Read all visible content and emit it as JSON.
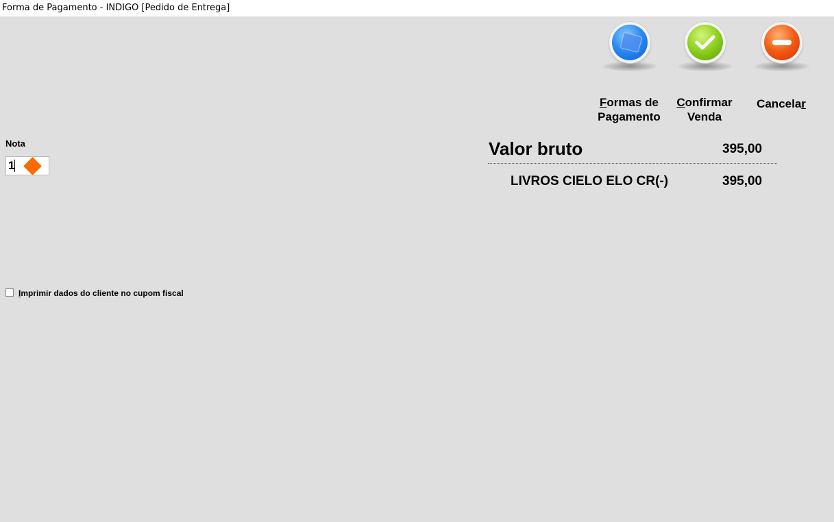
{
  "window": {
    "title": "Forma de Pagamento - INDIGO [Pedido de Entrega]"
  },
  "toolbar": {
    "formas": {
      "line1_first": "F",
      "line1_rest": "ormas de",
      "line2": "Pagamento",
      "icon": "payment-methods-icon"
    },
    "confirmar": {
      "line1_first": "C",
      "line1_rest": "onfirmar",
      "line2": "Venda",
      "icon": "checkmark-icon"
    },
    "cancelar": {
      "label_main": "Cancela",
      "label_ul": "r",
      "icon": "minus-icon"
    }
  },
  "nota": {
    "label": "Nota",
    "value": "1"
  },
  "totals": {
    "valor_bruto_label": "Valor bruto",
    "valor_bruto_value": "395,00",
    "payment_label": "LIVROS CIELO ELO CR(-)",
    "payment_value": "395,00"
  },
  "options": {
    "print_client_first": "I",
    "print_client_rest": "mprimir dados do cliente no cupom fiscal",
    "print_client_checked": false
  },
  "colors": {
    "background": "#dfdfdf",
    "accent_orange": "#ff6a00",
    "blue": "#2d8cf0",
    "green": "#8ccf1c",
    "red": "#f25a12"
  }
}
